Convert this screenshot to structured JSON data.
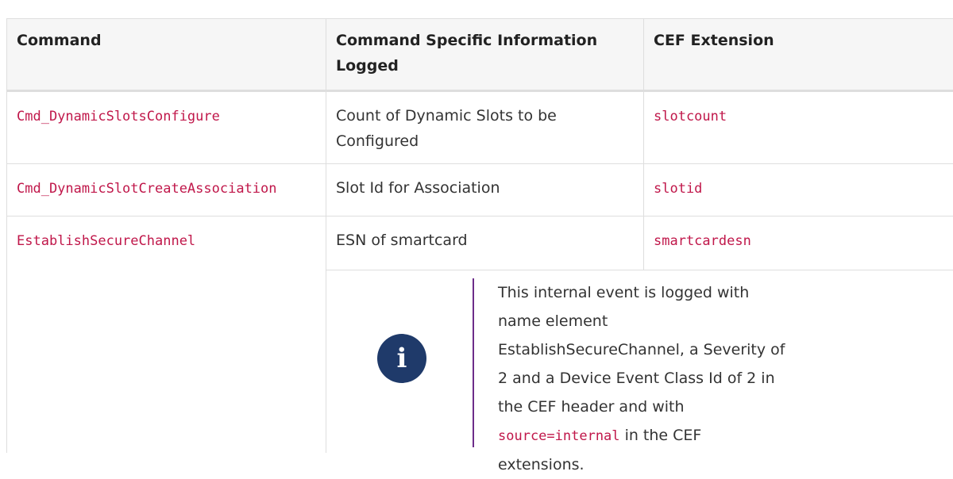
{
  "table": {
    "headers": [
      "Command",
      "Command Specific Information Logged",
      "CEF Extension"
    ],
    "rows": [
      {
        "command": "Cmd_DynamicSlotsConfigure",
        "info": "Count of Dynamic Slots to be Configured",
        "cef": "slotcount"
      },
      {
        "command": "Cmd_DynamicSlotCreateAssociation",
        "info": "Slot Id for Association",
        "cef": "slotid"
      },
      {
        "command": "EstablishSecureChannel",
        "info": "ESN of smartcard",
        "cef": "smartcardesn"
      }
    ]
  },
  "note": {
    "icon": "info-icon",
    "icon_glyph": "i",
    "text_before": "This internal event is logged with name element EstablishSecureChannel, a Severity of 2 and a Device Event Class Id of 2 in the CEF header and with ",
    "code": "source=internal",
    "text_after": " in the CEF extensions.",
    "colors": {
      "icon_bg": "#1f3a6a",
      "bar": "#6d2d8a",
      "code": "#c0174a"
    }
  }
}
